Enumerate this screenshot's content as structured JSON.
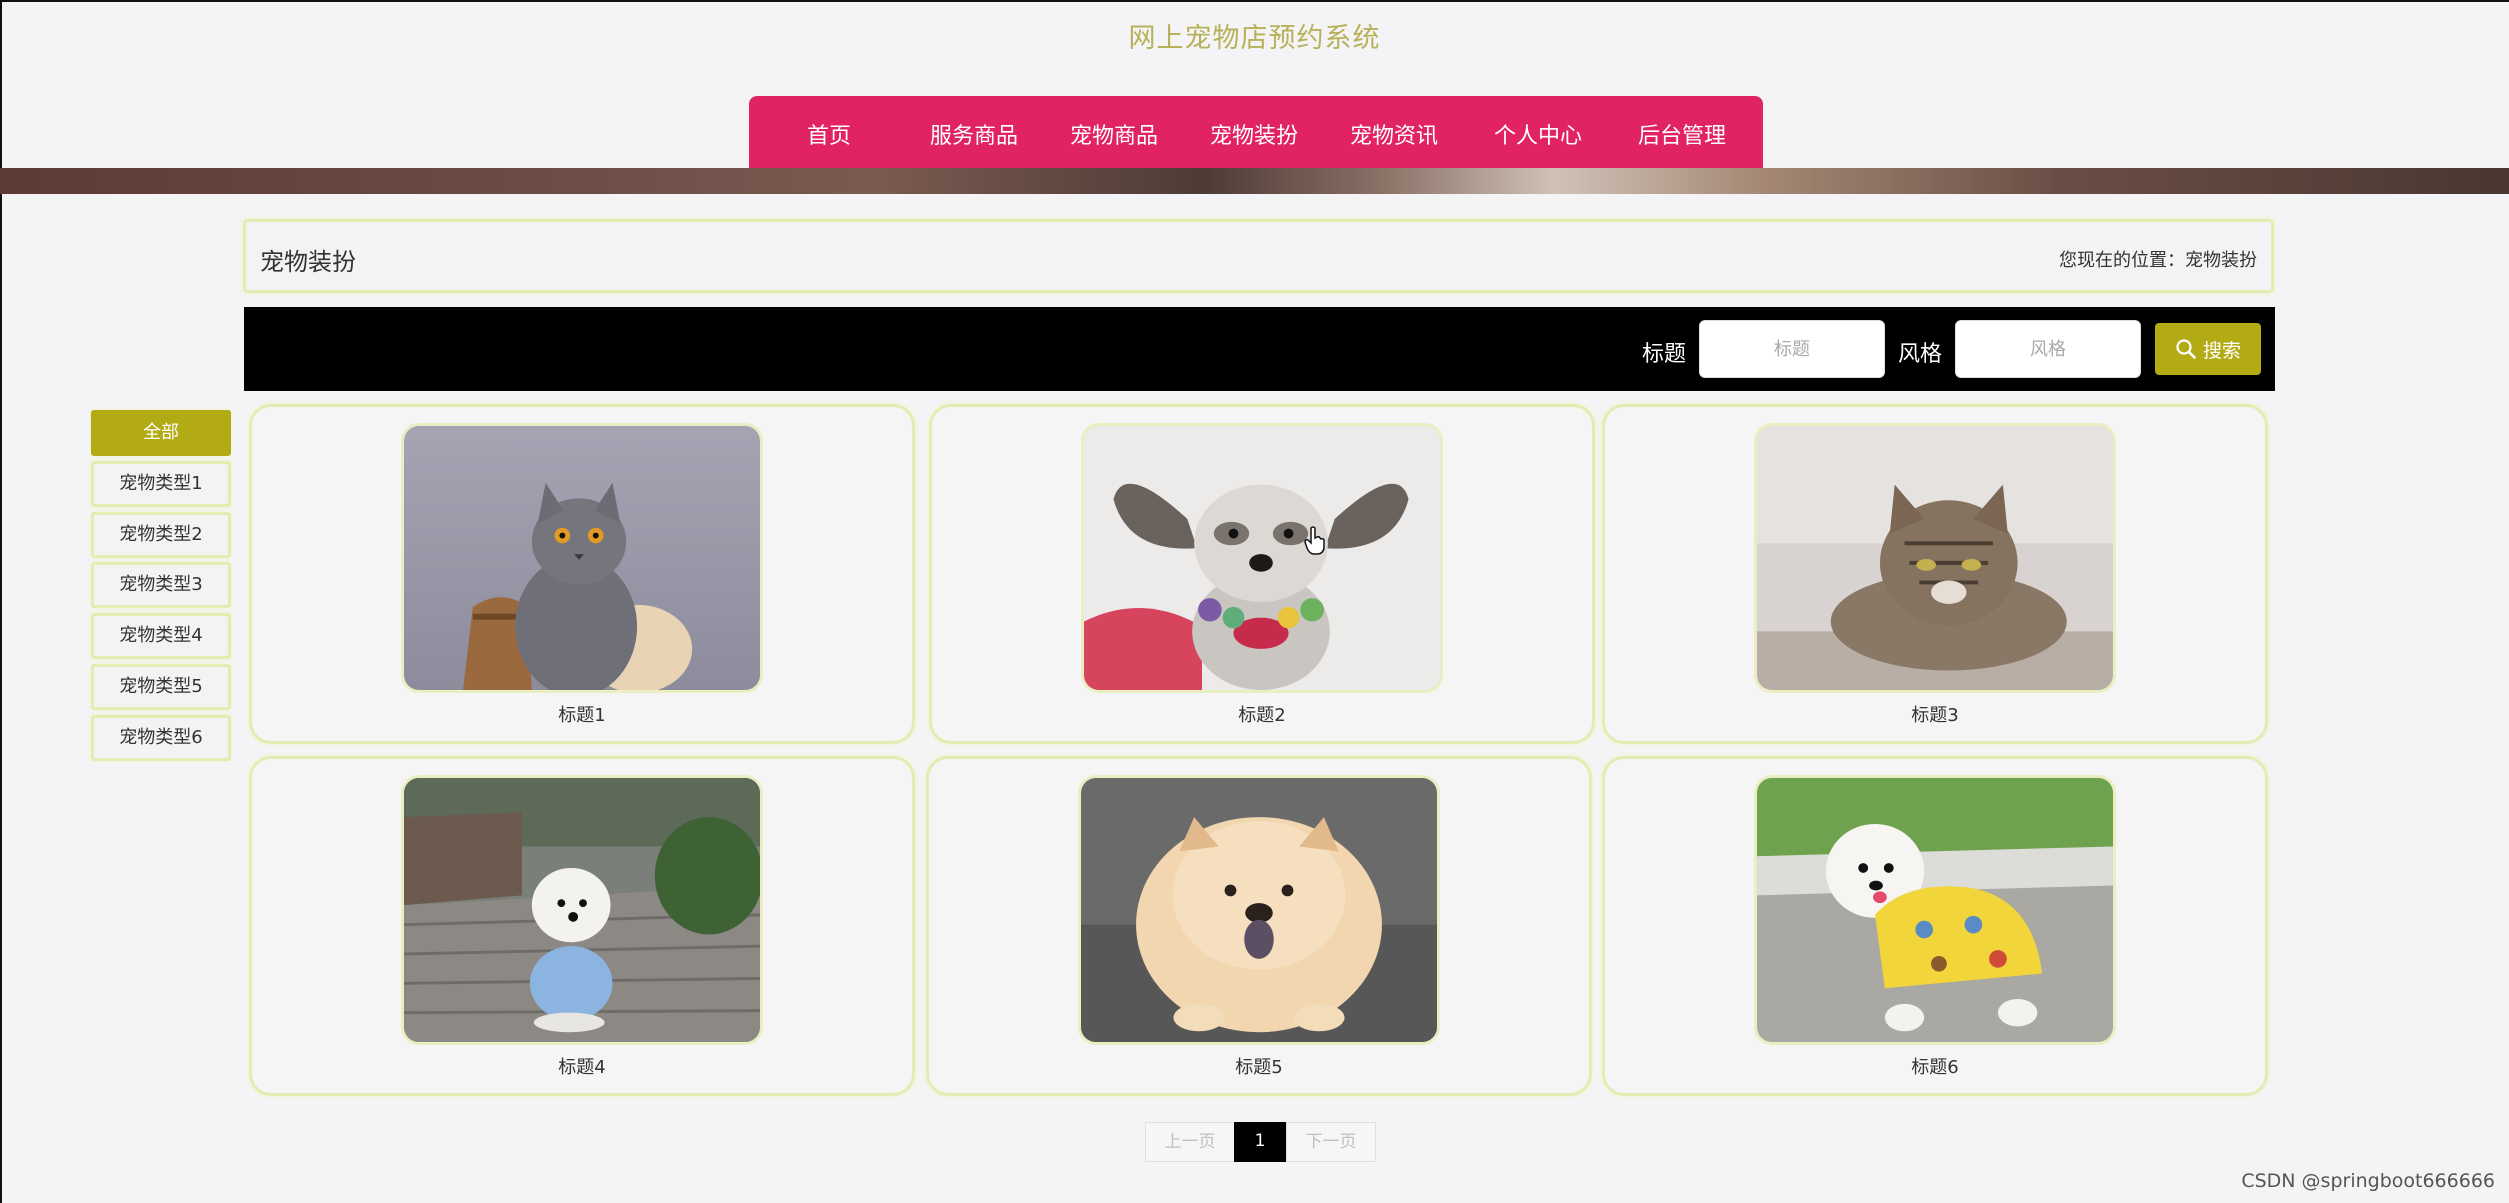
{
  "site": {
    "title": "网上宠物店预约系统"
  },
  "nav": {
    "items": [
      {
        "label": "首页"
      },
      {
        "label": "服务商品"
      },
      {
        "label": "宠物商品"
      },
      {
        "label": "宠物装扮"
      },
      {
        "label": "宠物资讯"
      },
      {
        "label": "个人中心"
      },
      {
        "label": "后台管理"
      }
    ]
  },
  "breadcrumb": {
    "title": "宠物装扮",
    "location": "您现在的位置：宠物装扮"
  },
  "search": {
    "title_label": "标题",
    "title_placeholder": "标题",
    "style_label": "风格",
    "style_placeholder": "风格",
    "button_label": "搜索",
    "button_icon": "search-icon"
  },
  "sidebar": {
    "items": [
      {
        "label": "全部",
        "active": true
      },
      {
        "label": "宠物类型1"
      },
      {
        "label": "宠物类型2"
      },
      {
        "label": "宠物类型3"
      },
      {
        "label": "宠物类型4"
      },
      {
        "label": "宠物类型5"
      },
      {
        "label": "宠物类型6"
      }
    ]
  },
  "cards": [
    {
      "label": "标题1",
      "photo": "gray cat"
    },
    {
      "label": "标题2",
      "photo": "schnauzer puppy"
    },
    {
      "label": "标题3",
      "photo": "tabby cat"
    },
    {
      "label": "标题4",
      "photo": "white poodle in blue coat"
    },
    {
      "label": "标题5",
      "photo": "chow chow puppy"
    },
    {
      "label": "标题6",
      "photo": "white poodle in yellow sweater"
    }
  ],
  "pagination": {
    "prev": "上一页",
    "current": "1",
    "next": "下一页"
  },
  "watermark": "CSDN @springboot666666",
  "colors": {
    "nav": "#e12365",
    "accent": "#b3ab14",
    "title": "#b7b15a",
    "card_border": "#e4ecb1"
  }
}
